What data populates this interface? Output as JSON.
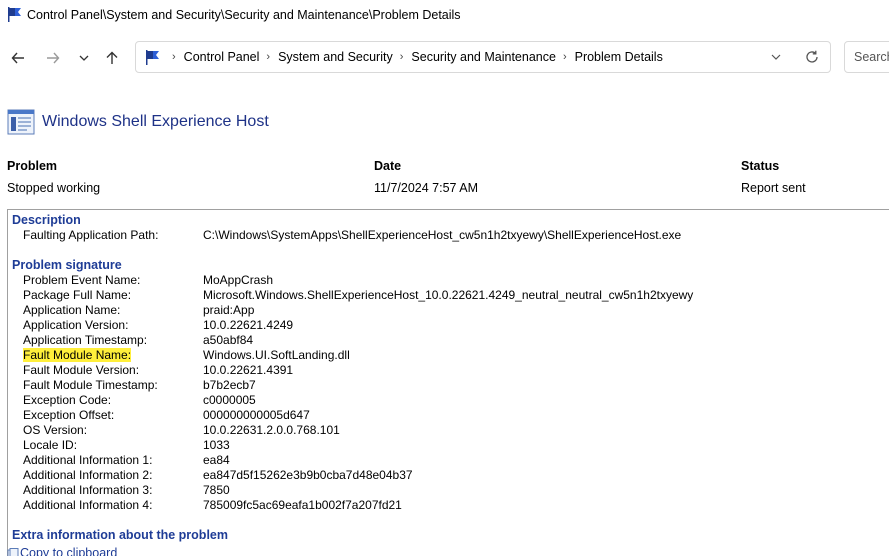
{
  "window": {
    "title": "Control Panel\\System and Security\\Security and Maintenance\\Problem Details"
  },
  "nav": {
    "back_icon": "arrow-left-icon",
    "forward_icon": "arrow-right-icon",
    "recent_icon": "chevron-down-icon",
    "up_icon": "arrow-up-icon"
  },
  "address": {
    "crumbs": [
      "Control Panel",
      "System and Security",
      "Security and Maintenance",
      "Problem Details"
    ]
  },
  "search": {
    "placeholder": "Search Control Panel"
  },
  "app": {
    "title": "Windows Shell Experience Host"
  },
  "summary": {
    "problem_label": "Problem",
    "problem_value": "Stopped working",
    "date_label": "Date",
    "date_value": "11/7/2024 7:57 AM",
    "status_label": "Status",
    "status_value": "Report sent"
  },
  "description": {
    "heading": "Description",
    "rows": [
      {
        "label": "Faulting Application Path:",
        "value": "C:\\Windows\\SystemApps\\ShellExperienceHost_cw5n1h2txyewy\\ShellExperienceHost.exe"
      }
    ]
  },
  "signature": {
    "heading": "Problem signature",
    "rows": [
      {
        "label": "Problem Event Name:",
        "value": "MoAppCrash"
      },
      {
        "label": "Package Full Name:",
        "value": "Microsoft.Windows.ShellExperienceHost_10.0.22621.4249_neutral_neutral_cw5n1h2txyewy"
      },
      {
        "label": "Application Name:",
        "value": "praid:App"
      },
      {
        "label": "Application Version:",
        "value": "10.0.22621.4249"
      },
      {
        "label": "Application Timestamp:",
        "value": "a50abf84"
      },
      {
        "label": "Fault Module Name:",
        "value": "Windows.UI.SoftLanding.dll"
      },
      {
        "label": "Fault Module Version:",
        "value": "10.0.22621.4391"
      },
      {
        "label": "Fault Module Timestamp:",
        "value": "b7b2ecb7"
      },
      {
        "label": "Exception Code:",
        "value": "c0000005"
      },
      {
        "label": "Exception Offset:",
        "value": "000000000005d647"
      },
      {
        "label": "OS Version:",
        "value": "10.0.22631.2.0.0.768.101"
      },
      {
        "label": "Locale ID:",
        "value": "1033"
      },
      {
        "label": "Additional Information 1:",
        "value": "ea84"
      },
      {
        "label": "Additional Information 2:",
        "value": "ea847d5f15262e3b9b0cba7d48e04b37"
      },
      {
        "label": "Additional Information 3:",
        "value": "7850"
      },
      {
        "label": "Additional Information 4:",
        "value": "785009fc5ac69eafa1b002f7a207fd21"
      }
    ]
  },
  "extra": {
    "heading": "Extra information about the problem"
  },
  "actions": {
    "copy_label": "Copy to clipboard"
  },
  "colors": {
    "heading_blue": "#1e3c96",
    "title_blue": "#1e3287",
    "highlight": "#ffef3b"
  }
}
